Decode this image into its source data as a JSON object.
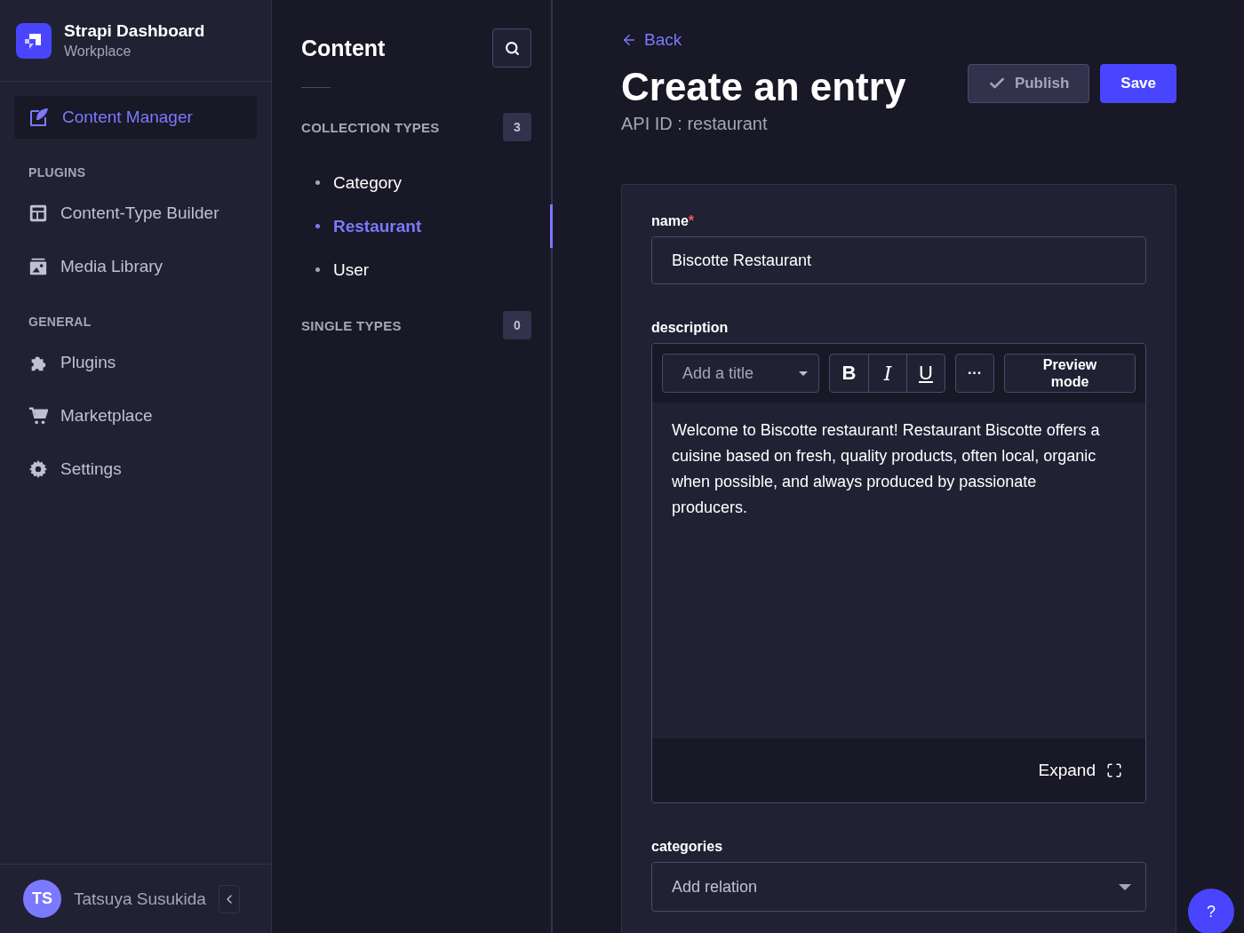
{
  "brand": {
    "title": "Strapi Dashboard",
    "subtitle": "Workplace"
  },
  "sidebar": {
    "top_item": {
      "label": "Content Manager",
      "selected": true
    },
    "sections": [
      {
        "heading": "PLUGINS",
        "items": [
          {
            "label": "Content-Type Builder",
            "selected": false
          },
          {
            "label": "Media Library",
            "selected": false
          }
        ]
      },
      {
        "heading": "GENERAL",
        "items": [
          {
            "label": "Plugins",
            "selected": false
          },
          {
            "label": "Marketplace",
            "selected": false
          },
          {
            "label": "Settings",
            "selected": false
          }
        ]
      }
    ],
    "user": {
      "initials": "TS",
      "name": "Tatsuya Susukida"
    }
  },
  "content_nav": {
    "title": "Content",
    "groups": [
      {
        "heading": "COLLECTION TYPES",
        "count": "3",
        "items": [
          {
            "label": "Category",
            "selected": false
          },
          {
            "label": "Restaurant",
            "selected": true
          },
          {
            "label": "User",
            "selected": false
          }
        ]
      },
      {
        "heading": "SINGLE TYPES",
        "count": "0"
      }
    ]
  },
  "header": {
    "back": "Back",
    "title": "Create an entry",
    "subtitle": "API ID : restaurant",
    "publish": "Publish",
    "save": "Save"
  },
  "form": {
    "name": {
      "label": "name",
      "required_mark": "*",
      "value": "Biscotte Restaurant"
    },
    "description": {
      "label": "description",
      "heading_select": "Add a title",
      "bold": "B",
      "italic": "I",
      "underline": "U",
      "more": "···",
      "preview": "Preview mode",
      "text": "Welcome to Biscotte restaurant! Restaurant Biscotte offers a cuisine based on fresh, quality products, often local, organic when possible, and always produced by passionate producers.",
      "expand": "Expand"
    },
    "categories": {
      "label": "categories",
      "placeholder": "Add relation"
    }
  },
  "help": "?"
}
